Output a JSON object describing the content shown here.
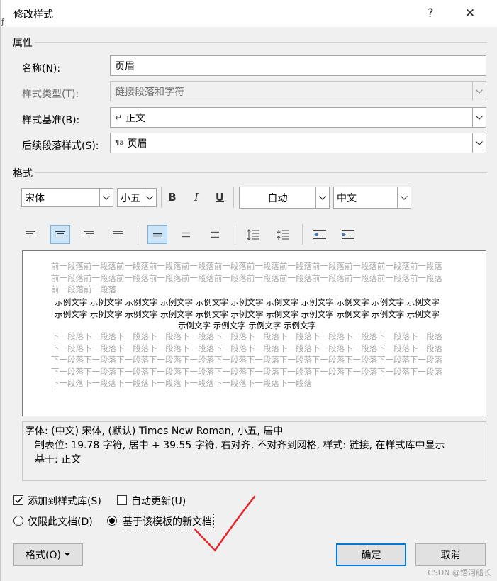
{
  "window": {
    "title": "修改样式",
    "help": "?",
    "close": "✕"
  },
  "properties": {
    "section": "属性",
    "name_label": "名称(N):",
    "name_value": "页眉",
    "type_label": "样式类型(T):",
    "type_value": "链接段落和字符",
    "based_label": "样式基准(B):",
    "based_value": "正文",
    "next_label": "后续段落样式(S):",
    "next_value": "页眉"
  },
  "format": {
    "section": "格式",
    "font": "宋体",
    "size": "小五",
    "bold": "B",
    "italic": "I",
    "underline": "U",
    "color": "自动",
    "script": "中文"
  },
  "preview": {
    "prev": "前一段落前一段落前一段落前一段落前一段落前一段落前一段落前一段落前一段落前一段落前一段落前一段落前一段落前一段落前一段落前一段落前一段落前一段落前一段落前一段落前一段落前一段落前一段落前一段落前一段落前一段落",
    "sample": "示例文字 示例文字 示例文字 示例文字 示例文字 示例文字 示例文字 示例文字 示例文字 示例文字 示例文字 示例文字 示例文字 示例文字 示例文字 示例文字 示例文字 示例文字 示例文字 示例文字 示例文字 示例文字 示例文字 示例文字 示例文字 示例文字",
    "next": "下一段落下一段落下一段落下一段落下一段落下一段落下一段落下一段落下一段落下一段落下一段落下一段落下一段落下一段落下一段落下一段落下一段落下一段落下一段落下一段落下一段落下一段落下一段落下一段落下一段落下一段落下一段落下一段落下一段落下一段落下一段落下一段落下一段落下一段落下一段落下一段落下一段落下一段落下一段落下一段落下一段落下一段落下一段落下一段落下一段落下一段落下一段落下一段落下一段落下一段落下一段落下一段落下一段落下一段落下一段落下一段落"
  },
  "description": {
    "line1": "字体: (中文) 宋体, (默认) Times New Roman, 小五, 居中",
    "line2": "制表位:  19.78 字符, 居中 +  39.55 字符, 右对齐, 不对齐到网格, 样式: 链接, 在样式库中显示",
    "line3": "基于: 正文"
  },
  "options": {
    "add_to_gallery": "添加到样式库(S)",
    "add_to_gallery_checked": true,
    "auto_update": "自动更新(U)",
    "auto_update_checked": false,
    "only_this_doc": "仅限此文档(D)",
    "new_docs_template": "基于该模板的新文档",
    "selected_radio": "new_docs_template"
  },
  "buttons": {
    "format": "格式(O)",
    "ok": "确定",
    "cancel": "取消"
  },
  "watermark": "CSDN @悟河船长",
  "colors": {
    "accent": "#0078d7",
    "annotation": "#e8232a",
    "active_btn": "#cce4f7"
  }
}
